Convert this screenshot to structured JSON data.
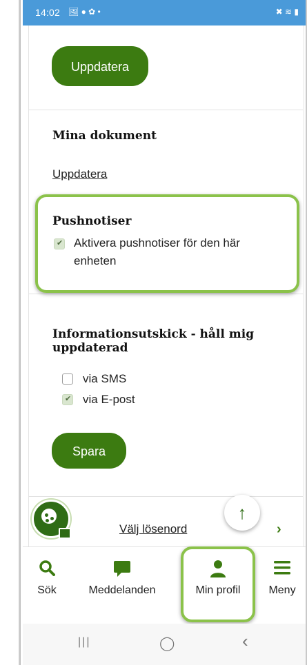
{
  "status_bar": {
    "time": "14:02",
    "left_icons": "🖼 ● ✿ •",
    "right_icons": "✖ ≋ ▮"
  },
  "profile": {
    "update_button": "Uppdatera",
    "documents_heading": "Mina dokument",
    "documents_link": "Uppdatera",
    "push_heading": "Pushnotiser",
    "push_checkbox_label": "Aktivera pushnotiser för den här enheten",
    "push_checked": true,
    "newsletter_heading": "Informationsutskick - håll mig uppdaterad",
    "options": [
      {
        "label": "via SMS",
        "checked": false
      },
      {
        "label": "via E-post",
        "checked": true
      }
    ],
    "save_button": "Spara",
    "choose_password_link": "Välj lösenord",
    "chevron": "›"
  },
  "bottom_nav": {
    "items": [
      {
        "label": "Sök",
        "icon": "search-icon"
      },
      {
        "label": "Meddelanden",
        "icon": "chat-icon"
      },
      {
        "label": "Min profil",
        "icon": "person-icon"
      },
      {
        "label": "Meny",
        "icon": "menu-icon"
      }
    ]
  },
  "android_nav": {
    "recent": "|||",
    "home": "◯",
    "back": "‹"
  },
  "colors": {
    "brand_green": "#3c7b11",
    "highlight_green": "#8bc24a",
    "status_bar_blue": "#4a9ad9"
  }
}
